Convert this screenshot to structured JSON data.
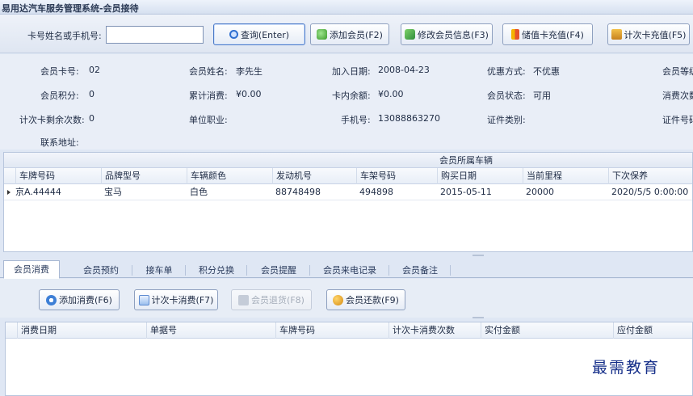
{
  "window": {
    "title": "易用达汽车服务管理系统-会员接待"
  },
  "toolbar": {
    "search_label": "卡号姓名或手机号:",
    "search_value": "",
    "buttons": {
      "query": "查询(Enter)",
      "add_member": "添加会员(F2)",
      "edit_member": "修改会员信息(F3)",
      "stored_value": "储值卡充值(F4)",
      "times_card": "计次卡充值(F5)"
    }
  },
  "member": {
    "card_no_label": "会员卡号:",
    "card_no": "02",
    "name_label": "会员姓名:",
    "name": "李先生",
    "join_date_label": "加入日期:",
    "join_date": "2008-04-23",
    "discount_label": "优惠方式:",
    "discount": "不优惠",
    "level_label": "会员等级",
    "points_label": "会员积分:",
    "points": "0",
    "total_spent_label": "累计消费:",
    "total_spent": "¥0.00",
    "balance_label": "卡内余额:",
    "balance": "¥0.00",
    "status_label": "会员状态:",
    "status": "可用",
    "visit_count_label": "消费次数",
    "times_left_label": "计次卡剩余次数:",
    "times_left": "0",
    "work_unit_label": "单位职业:",
    "work_unit": "",
    "phone_label": "手机号:",
    "phone": "13088863270",
    "id_type_label": "证件类别:",
    "id_type": "",
    "id_no_label": "证件号码",
    "address_label": "联系地址:",
    "address": ""
  },
  "vehicles": {
    "caption": "会员所属车辆",
    "columns": [
      "车牌号码",
      "品牌型号",
      "车辆颜色",
      "发动机号",
      "车架号码",
      "购买日期",
      "当前里程",
      "下次保养"
    ],
    "rows": [
      [
        "京A.44444",
        "宝马",
        "白色",
        "88748498",
        "494898",
        "2015-05-11",
        "20000",
        "2020/5/5 0:00:00"
      ]
    ]
  },
  "tabs": [
    "会员消费",
    "会员预约",
    "接车单",
    "积分兑换",
    "会员提醒",
    "会员来电记录",
    "会员备注"
  ],
  "actions": {
    "add_consume": "添加消费(F6)",
    "times_consume": "计次卡消费(F7)",
    "member_return": "会员退货(F8)",
    "member_repay": "会员还款(F9)"
  },
  "consume_grid": {
    "columns": [
      "消费日期",
      "单据号",
      "车牌号码",
      "计次卡消费次数",
      "实付金额",
      "应付金额"
    ]
  },
  "watermark": "最需教育"
}
